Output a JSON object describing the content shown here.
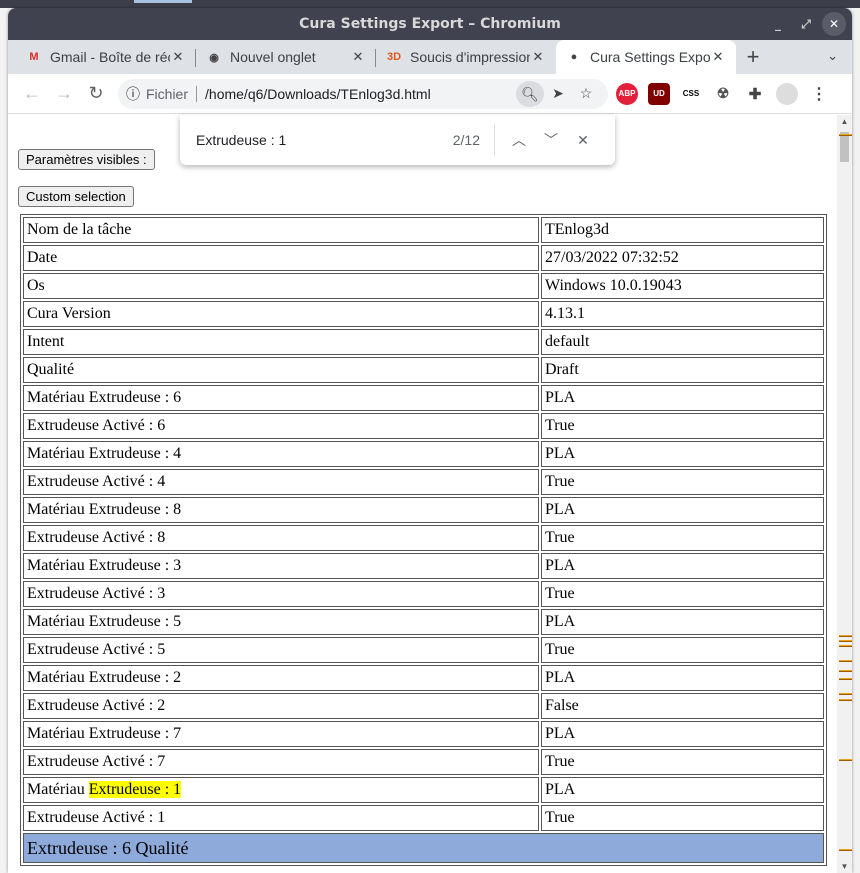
{
  "window": {
    "title": "Cura Settings Export – Chromium"
  },
  "tabs": [
    {
      "label": "Gmail - Boîte de réception",
      "icon": "gmail-icon"
    },
    {
      "label": "Nouvel onglet",
      "icon": "chrome-icon"
    },
    {
      "label": "Soucis d'impression",
      "icon": "3d-icon"
    },
    {
      "label": "Cura Settings Export",
      "icon": "globe-icon",
      "active": true
    }
  ],
  "address": {
    "scheme_label": "Fichier",
    "url": "/home/q6/Downloads/TEnlog3d.html"
  },
  "extensions": [
    "ABP",
    "UD",
    "CSS"
  ],
  "find": {
    "query": "Extrudeuse : 1",
    "count": "2/12"
  },
  "page": {
    "visible_params_button": "Paramètres visibles :",
    "custom_selection_button": "Custom selection",
    "rows": [
      [
        "Nom de la tâche",
        "TEnlog3d"
      ],
      [
        "Date",
        "27/03/2022 07:32:52"
      ],
      [
        "Os",
        "Windows 10.0.19043"
      ],
      [
        "Cura Version",
        "4.13.1"
      ],
      [
        "Intent",
        "default"
      ],
      [
        "Qualité",
        "Draft"
      ],
      [
        "Matériau Extrudeuse : 6",
        "PLA"
      ],
      [
        "Extrudeuse Activé : 6",
        "True"
      ],
      [
        "Matériau Extrudeuse : 4",
        "PLA"
      ],
      [
        "Extrudeuse Activé : 4",
        "True"
      ],
      [
        "Matériau Extrudeuse : 8",
        "PLA"
      ],
      [
        "Extrudeuse Activé : 8",
        "True"
      ],
      [
        "Matériau Extrudeuse : 3",
        "PLA"
      ],
      [
        "Extrudeuse Activé : 3",
        "True"
      ],
      [
        "Matériau Extrudeuse : 5",
        "PLA"
      ],
      [
        "Extrudeuse Activé : 5",
        "True"
      ],
      [
        "Matériau Extrudeuse : 2",
        "PLA"
      ],
      [
        "Extrudeuse Activé : 2",
        "False"
      ],
      [
        "Matériau Extrudeuse : 7",
        "PLA"
      ],
      [
        "Extrudeuse Activé : 7",
        "True"
      ]
    ],
    "highlight_row": {
      "prefix": "Matériau ",
      "match": "Extrudeuse : 1",
      "value": "PLA"
    },
    "last_row": [
      "Extrudeuse Activé : 1",
      "True"
    ],
    "section_header": "Extrudeuse : 6 Qualité"
  },
  "colors": {
    "section": "#8eaadb",
    "highlight": "#ffff00",
    "titlebar": "#40434f"
  }
}
